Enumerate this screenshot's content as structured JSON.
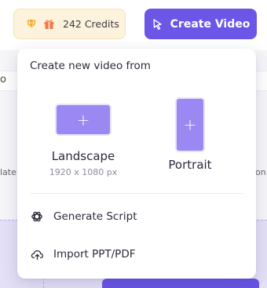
{
  "background": {
    "edge_left_char": "o",
    "edge_left_text": "late",
    "edge_right_text": "ion"
  },
  "header": {
    "credits_label": "242 Credits",
    "create_button_label": "Create Video"
  },
  "dropdown": {
    "title": "Create new video from",
    "options": [
      {
        "label": "Landscape",
        "sublabel": "1920 x 1080 px",
        "icon": "plus-icon"
      },
      {
        "label": "Portrait",
        "icon": "plus-icon"
      }
    ],
    "menu": [
      {
        "label": "Generate Script",
        "icon": "openai-icon"
      },
      {
        "label": "Import PPT/PDF",
        "icon": "cloud-upload-icon"
      }
    ]
  },
  "colors": {
    "accent": "#6b56e8",
    "thumb": "#9b88f3",
    "credits_bg": "#fdf3dc"
  }
}
